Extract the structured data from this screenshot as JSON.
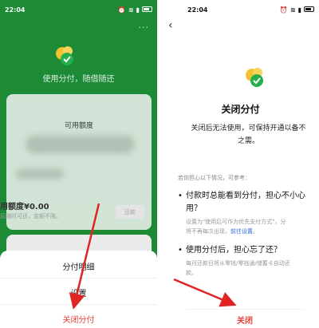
{
  "left": {
    "status_time": "22:04",
    "slogan": "使用分付，随借随还",
    "available_label": "可用额度",
    "quota_text": "用额度¥0.00",
    "quota_sub": "后随时可还，金额不限。",
    "repay_label": "还款",
    "menu": {
      "details": "分付明细",
      "settings": "设置",
      "close": "关闭分付"
    },
    "more": "···"
  },
  "right": {
    "status_time": "22:04",
    "back": "‹",
    "title": "关闭分付",
    "desc_line1": "关闭后无法使用，可保持开通以备不",
    "desc_line2": "之需。",
    "tips_title": "若你担心以下情况，可参考：",
    "q1_line1": "付款时总能看到分付，担心不小心",
    "q1_line2": "用？",
    "a1_line1": "设置为\"使用后可作为优先支付方式\"，分",
    "a1_line2_prefix": "将不再每次出现，",
    "a1_link": "前往设置",
    "a1_line2_suffix": "。",
    "q2_line1": "使用分付后，担心忘了还？",
    "a2_line1": "每月还款日将从零钱/零钱通/储蓄卡自动还",
    "a2_line2": "款。",
    "bullet": "•",
    "close_label": "关闭"
  },
  "colors": {
    "brand_green": "#1d8a36",
    "danger_red": "#e8403a",
    "link_blue": "#2f6bd8",
    "logo_yellow": "#f2c230",
    "logo_green": "#22b04b"
  }
}
